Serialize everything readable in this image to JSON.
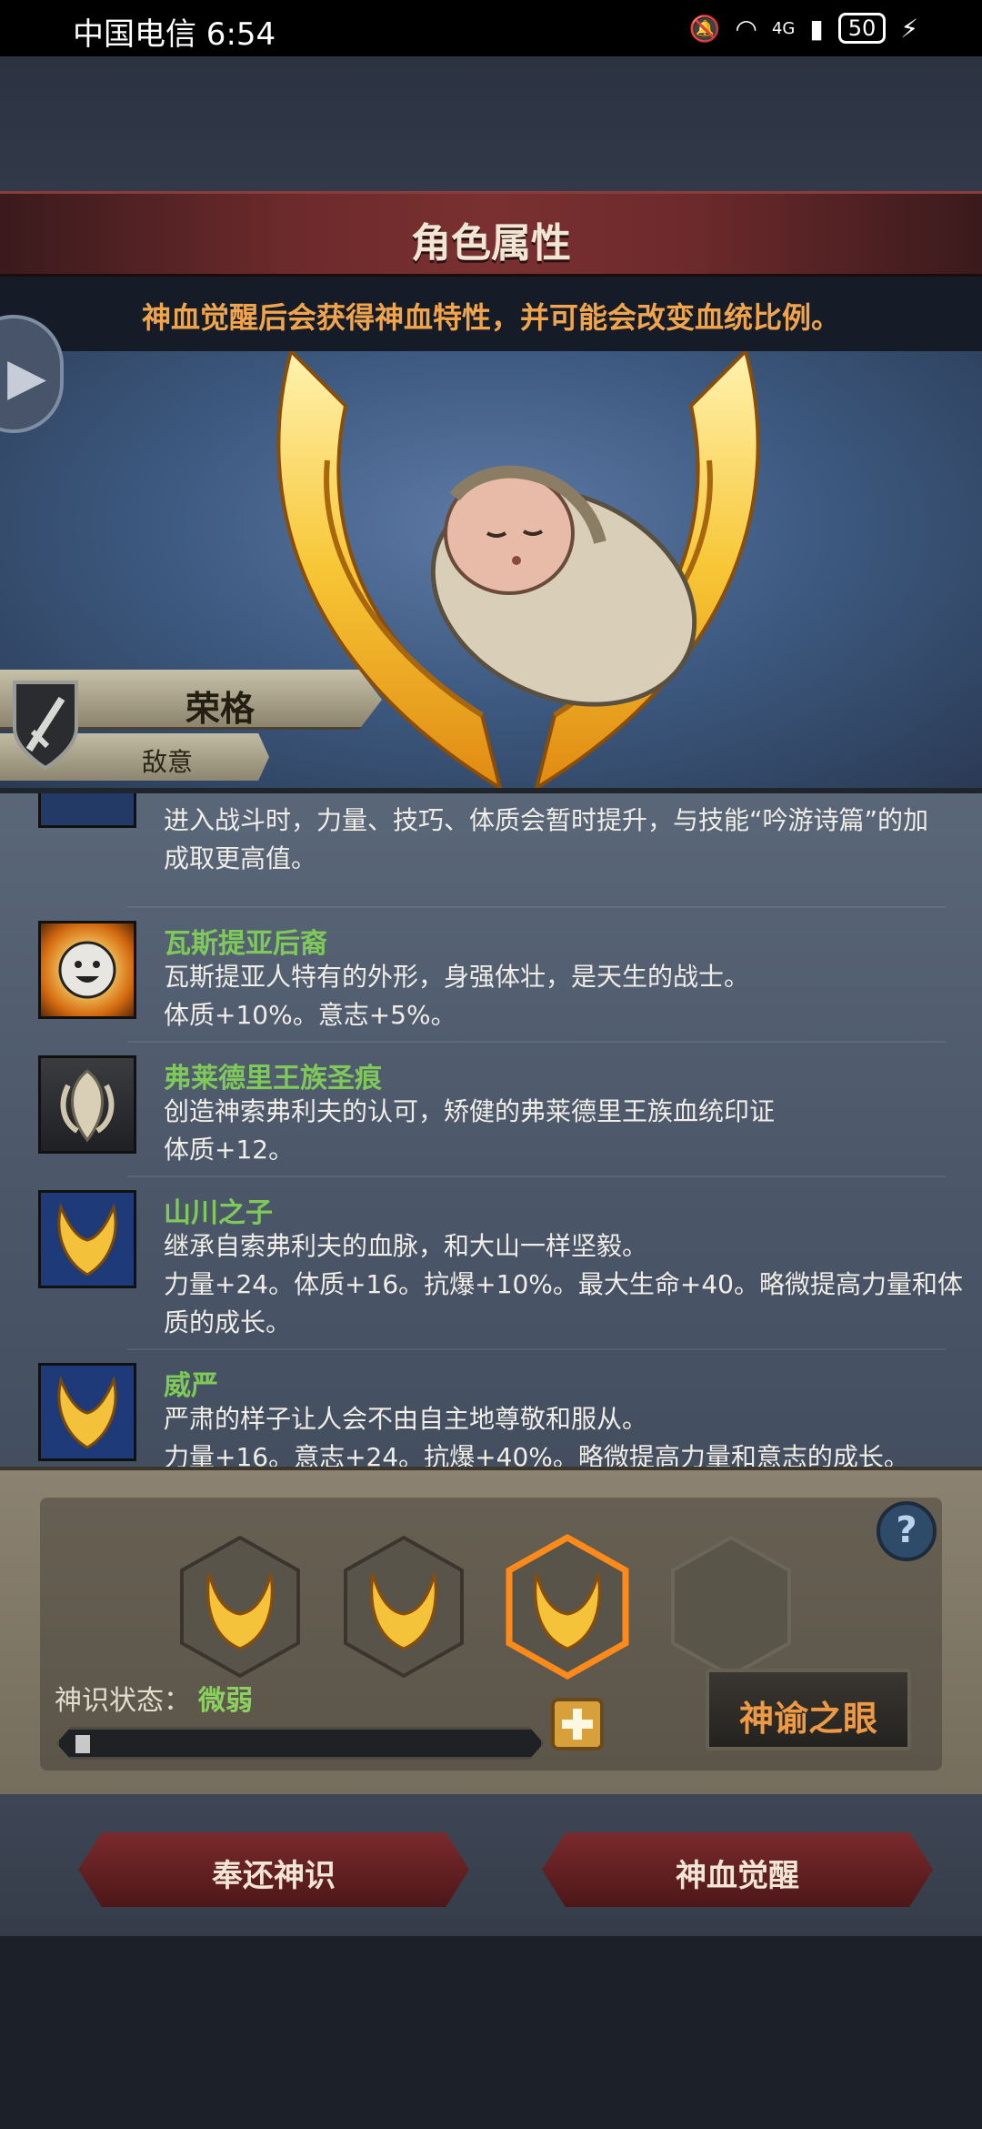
{
  "status_bar": {
    "carrier_time": "中国电信 6:54",
    "network": "4G",
    "battery": "50"
  },
  "header": {
    "title": "角色属性",
    "hint": "神血觉醒后会获得神血特性，并可能会改变血统比例。"
  },
  "character": {
    "name": "荣格",
    "title": "敌意"
  },
  "traits": [
    {
      "name": "",
      "lines": [
        "进入战斗时，力量、技巧、体质会暂时提升，与技能“吟游诗篇”的加",
        "成取更高值。"
      ]
    },
    {
      "name": "瓦斯提亚后裔",
      "lines": [
        "瓦斯提亚人特有的外形，身强体壮，是天生的战士。",
        "体质+10%。意志+5%。"
      ]
    },
    {
      "name": "弗莱德里王族圣痕",
      "lines": [
        "创造神索弗利夫的认可，矫健的弗莱德里王族血统印证",
        "体质+12。"
      ]
    },
    {
      "name": "山川之子",
      "lines": [
        "继承自索弗利夫的血脉，和大山一样坚毅。",
        "力量+24。体质+16。抗爆+10%。最大生命+40。略微提高力量和体",
        "质的成长。"
      ]
    },
    {
      "name": "威严",
      "lines": [
        "严肃的样子让人会不由自主地尊敬和服从。",
        "力量+16。意志+24。抗爆+40%。略微提高力量和意志的成长。"
      ]
    }
  ],
  "awakening": {
    "state_label": "神识状态：",
    "state_value": "微弱",
    "progress": 0.03,
    "oracle_button": "神谕之眼",
    "help": "?"
  },
  "actions": {
    "return_label": "奉还神识",
    "awaken_label": "神血觉醒"
  },
  "colors": {
    "accent_orange": "#f0a44b",
    "trait_green": "#7fc85a",
    "button_red": "#7a2a2c"
  }
}
